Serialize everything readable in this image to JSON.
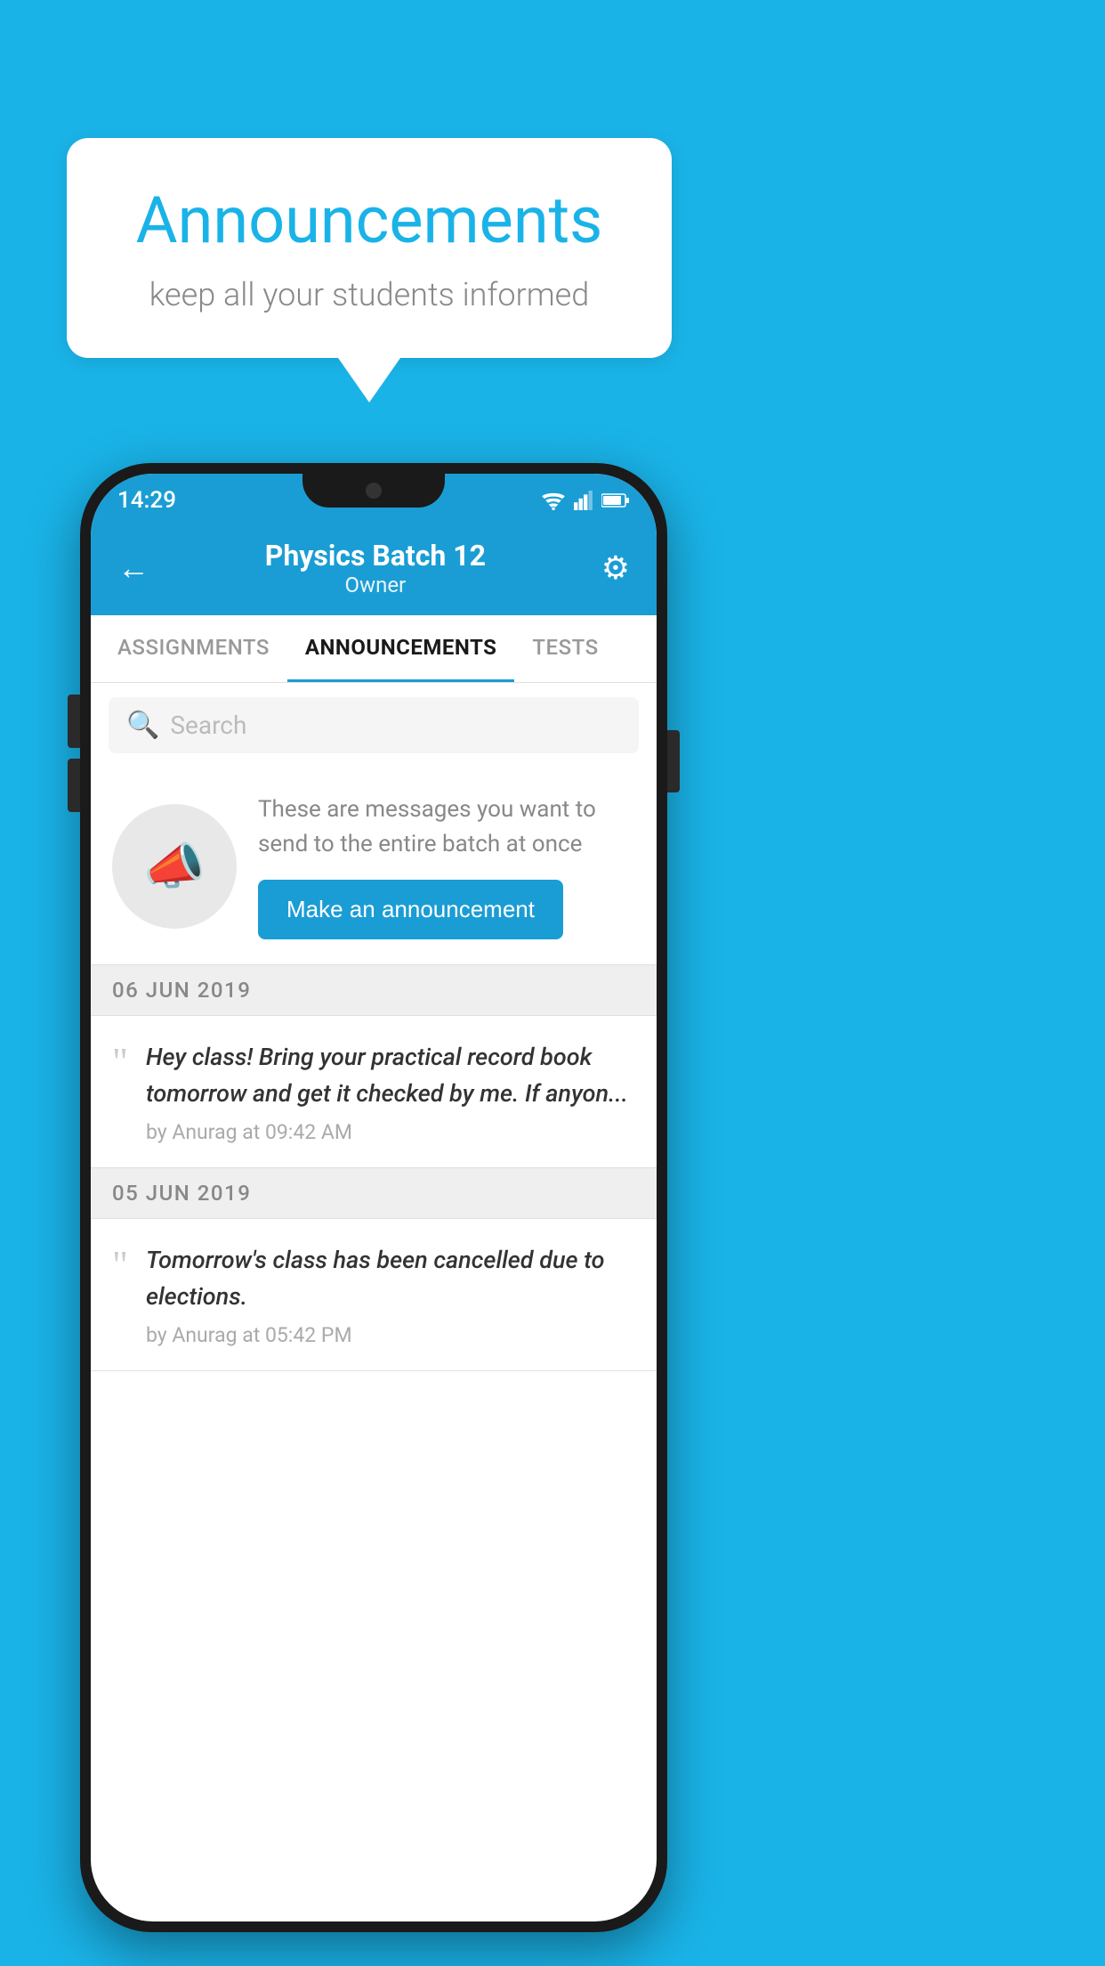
{
  "background_color": "#1ab3e8",
  "speech_bubble": {
    "title": "Announcements",
    "subtitle": "keep all your students informed"
  },
  "phone": {
    "status_bar": {
      "time": "14:29"
    },
    "header": {
      "title": "Physics Batch 12",
      "subtitle": "Owner",
      "back_label": "←",
      "gear_label": "⚙"
    },
    "tabs": [
      {
        "label": "ASSIGNMENTS",
        "active": false
      },
      {
        "label": "ANNOUNCEMENTS",
        "active": true
      },
      {
        "label": "TESTS",
        "active": false
      }
    ],
    "search": {
      "placeholder": "Search"
    },
    "promo": {
      "description": "These are messages you want to send to the entire batch at once",
      "button_label": "Make an announcement"
    },
    "announcements": [
      {
        "date": "06  JUN  2019",
        "text": "Hey class! Bring your practical record book tomorrow and get it checked by me. If anyon...",
        "meta": "by Anurag at 09:42 AM"
      },
      {
        "date": "05  JUN  2019",
        "text": "Tomorrow's class has been cancelled due to elections.",
        "meta": "by Anurag at 05:42 PM"
      }
    ]
  }
}
